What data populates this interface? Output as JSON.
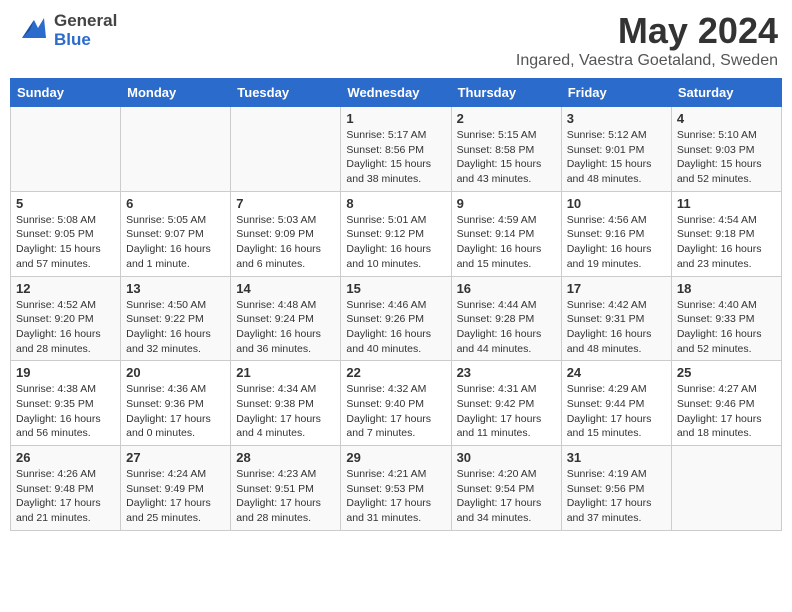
{
  "header": {
    "logo_general": "General",
    "logo_blue": "Blue",
    "month_title": "May 2024",
    "subtitle": "Ingared, Vaestra Goetaland, Sweden"
  },
  "days_of_week": [
    "Sunday",
    "Monday",
    "Tuesday",
    "Wednesday",
    "Thursday",
    "Friday",
    "Saturday"
  ],
  "weeks": [
    {
      "row_bg": "light",
      "days": [
        {
          "num": "",
          "info": ""
        },
        {
          "num": "",
          "info": ""
        },
        {
          "num": "",
          "info": ""
        },
        {
          "num": "1",
          "info": "Sunrise: 5:17 AM\nSunset: 8:56 PM\nDaylight: 15 hours\nand 38 minutes."
        },
        {
          "num": "2",
          "info": "Sunrise: 5:15 AM\nSunset: 8:58 PM\nDaylight: 15 hours\nand 43 minutes."
        },
        {
          "num": "3",
          "info": "Sunrise: 5:12 AM\nSunset: 9:01 PM\nDaylight: 15 hours\nand 48 minutes."
        },
        {
          "num": "4",
          "info": "Sunrise: 5:10 AM\nSunset: 9:03 PM\nDaylight: 15 hours\nand 52 minutes."
        }
      ]
    },
    {
      "row_bg": "dark",
      "days": [
        {
          "num": "5",
          "info": "Sunrise: 5:08 AM\nSunset: 9:05 PM\nDaylight: 15 hours\nand 57 minutes."
        },
        {
          "num": "6",
          "info": "Sunrise: 5:05 AM\nSunset: 9:07 PM\nDaylight: 16 hours\nand 1 minute."
        },
        {
          "num": "7",
          "info": "Sunrise: 5:03 AM\nSunset: 9:09 PM\nDaylight: 16 hours\nand 6 minutes."
        },
        {
          "num": "8",
          "info": "Sunrise: 5:01 AM\nSunset: 9:12 PM\nDaylight: 16 hours\nand 10 minutes."
        },
        {
          "num": "9",
          "info": "Sunrise: 4:59 AM\nSunset: 9:14 PM\nDaylight: 16 hours\nand 15 minutes."
        },
        {
          "num": "10",
          "info": "Sunrise: 4:56 AM\nSunset: 9:16 PM\nDaylight: 16 hours\nand 19 minutes."
        },
        {
          "num": "11",
          "info": "Sunrise: 4:54 AM\nSunset: 9:18 PM\nDaylight: 16 hours\nand 23 minutes."
        }
      ]
    },
    {
      "row_bg": "light",
      "days": [
        {
          "num": "12",
          "info": "Sunrise: 4:52 AM\nSunset: 9:20 PM\nDaylight: 16 hours\nand 28 minutes."
        },
        {
          "num": "13",
          "info": "Sunrise: 4:50 AM\nSunset: 9:22 PM\nDaylight: 16 hours\nand 32 minutes."
        },
        {
          "num": "14",
          "info": "Sunrise: 4:48 AM\nSunset: 9:24 PM\nDaylight: 16 hours\nand 36 minutes."
        },
        {
          "num": "15",
          "info": "Sunrise: 4:46 AM\nSunset: 9:26 PM\nDaylight: 16 hours\nand 40 minutes."
        },
        {
          "num": "16",
          "info": "Sunrise: 4:44 AM\nSunset: 9:28 PM\nDaylight: 16 hours\nand 44 minutes."
        },
        {
          "num": "17",
          "info": "Sunrise: 4:42 AM\nSunset: 9:31 PM\nDaylight: 16 hours\nand 48 minutes."
        },
        {
          "num": "18",
          "info": "Sunrise: 4:40 AM\nSunset: 9:33 PM\nDaylight: 16 hours\nand 52 minutes."
        }
      ]
    },
    {
      "row_bg": "dark",
      "days": [
        {
          "num": "19",
          "info": "Sunrise: 4:38 AM\nSunset: 9:35 PM\nDaylight: 16 hours\nand 56 minutes."
        },
        {
          "num": "20",
          "info": "Sunrise: 4:36 AM\nSunset: 9:36 PM\nDaylight: 17 hours\nand 0 minutes."
        },
        {
          "num": "21",
          "info": "Sunrise: 4:34 AM\nSunset: 9:38 PM\nDaylight: 17 hours\nand 4 minutes."
        },
        {
          "num": "22",
          "info": "Sunrise: 4:32 AM\nSunset: 9:40 PM\nDaylight: 17 hours\nand 7 minutes."
        },
        {
          "num": "23",
          "info": "Sunrise: 4:31 AM\nSunset: 9:42 PM\nDaylight: 17 hours\nand 11 minutes."
        },
        {
          "num": "24",
          "info": "Sunrise: 4:29 AM\nSunset: 9:44 PM\nDaylight: 17 hours\nand 15 minutes."
        },
        {
          "num": "25",
          "info": "Sunrise: 4:27 AM\nSunset: 9:46 PM\nDaylight: 17 hours\nand 18 minutes."
        }
      ]
    },
    {
      "row_bg": "light",
      "days": [
        {
          "num": "26",
          "info": "Sunrise: 4:26 AM\nSunset: 9:48 PM\nDaylight: 17 hours\nand 21 minutes."
        },
        {
          "num": "27",
          "info": "Sunrise: 4:24 AM\nSunset: 9:49 PM\nDaylight: 17 hours\nand 25 minutes."
        },
        {
          "num": "28",
          "info": "Sunrise: 4:23 AM\nSunset: 9:51 PM\nDaylight: 17 hours\nand 28 minutes."
        },
        {
          "num": "29",
          "info": "Sunrise: 4:21 AM\nSunset: 9:53 PM\nDaylight: 17 hours\nand 31 minutes."
        },
        {
          "num": "30",
          "info": "Sunrise: 4:20 AM\nSunset: 9:54 PM\nDaylight: 17 hours\nand 34 minutes."
        },
        {
          "num": "31",
          "info": "Sunrise: 4:19 AM\nSunset: 9:56 PM\nDaylight: 17 hours\nand 37 minutes."
        },
        {
          "num": "",
          "info": ""
        }
      ]
    }
  ]
}
